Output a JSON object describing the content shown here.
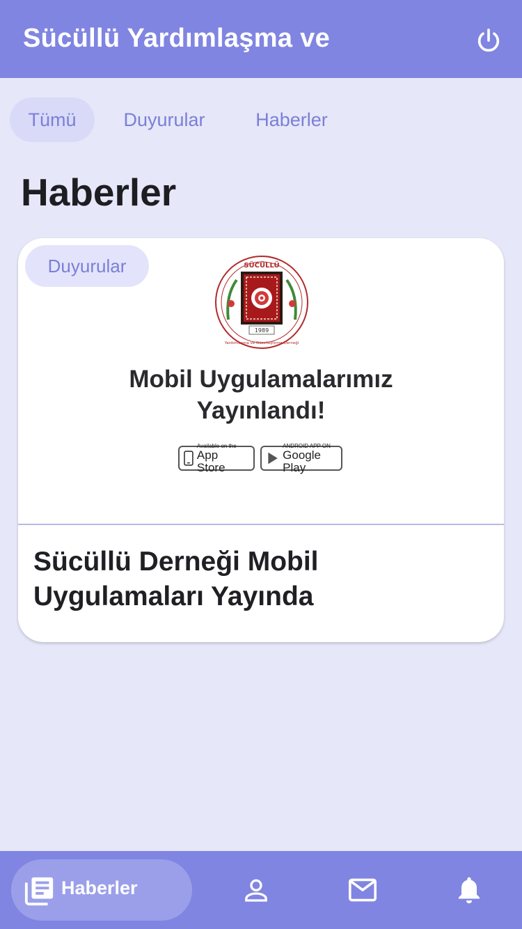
{
  "appbar": {
    "title": "Sücüllü Yardımlaşma ve",
    "power_icon": "power-icon"
  },
  "tabs": [
    {
      "label": "Tümü",
      "active": true
    },
    {
      "label": "Duyurular",
      "active": false
    },
    {
      "label": "Haberler",
      "active": false
    }
  ],
  "section_title": "Haberler",
  "card": {
    "category_chip": "Duyurular",
    "image": {
      "logo_top_text": "SÜCÜLLÜ",
      "logo_year": "1989",
      "logo_ring_text": "Yardımlaşma ve Güzelleştirme Derneği",
      "heading_line1": "Mobil Uygulamalarımız",
      "heading_line2": "Yayınlandı!",
      "app_store_small": "Available on the",
      "app_store_big": "App Store",
      "google_play_small": "ANDROID APP ON",
      "google_play_big": "Google Play"
    },
    "title": "Sücüllü Derneği Mobil Uygulamaları Yayında"
  },
  "bottom_nav": {
    "items": [
      {
        "label": "Haberler",
        "icon": "newspaper-icon",
        "active": true
      },
      {
        "label": "",
        "icon": "person-icon",
        "active": false
      },
      {
        "label": "",
        "icon": "mail-icon",
        "active": false
      },
      {
        "label": "",
        "icon": "bell-icon",
        "active": false
      }
    ]
  },
  "colors": {
    "primary": "#8085e2",
    "background": "#e6e7f8",
    "tab_active_bg": "#d8daf8",
    "accent_text": "#7b7fd6"
  }
}
